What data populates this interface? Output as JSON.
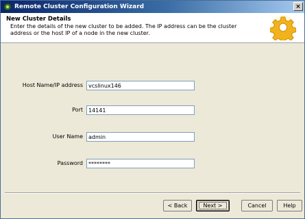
{
  "window": {
    "title": "Remote Cluster Configuration Wizard",
    "close_label": "×",
    "icon": "wizard-icon"
  },
  "header": {
    "title": "New Cluster Details",
    "description": "Enter the details of the new cluster to be added. The IP address can be the cluster address or the host IP of a node in the new cluster.",
    "icon": "gear-icon"
  },
  "form": {
    "host": {
      "label": "Host Name/IP address",
      "value": "vcslinux146"
    },
    "port": {
      "label": "Port",
      "value": "14141"
    },
    "user": {
      "label": "User Name",
      "value": "admin"
    },
    "password": {
      "label": "Password",
      "value": "********"
    }
  },
  "buttons": {
    "back": "< Back",
    "next": "Next >",
    "cancel": "Cancel",
    "help": "Help"
  },
  "colors": {
    "title_bar_start": "#0a246a",
    "title_bar_end": "#a6caf0",
    "dialog_bg": "#ece9d8"
  }
}
